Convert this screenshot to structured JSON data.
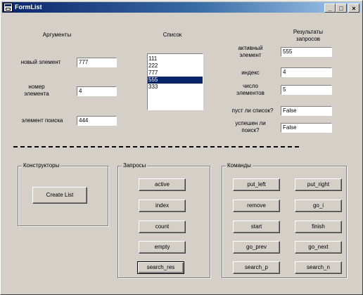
{
  "window": {
    "title": "FormList",
    "min_glyph": "_",
    "max_glyph": "□",
    "close_glyph": "×"
  },
  "labels": {
    "args_header": "Аргументы",
    "list_header": "Список",
    "results_header": "Результаты запросов",
    "new_item": "новый элемент",
    "item_number": "номер элемента",
    "search_item": "элемент поиска",
    "active_item": "активный элемент",
    "index": "индекс",
    "count": "число элементов",
    "is_empty": "пуст ли список?",
    "search_success": "успешен ли поиск?"
  },
  "inputs": {
    "new_item": "777",
    "item_number": "4",
    "search_item": "444",
    "active_item": "555",
    "index": "4",
    "count": "5",
    "is_empty": "False",
    "search_success": "False"
  },
  "list": {
    "items": [
      "111",
      "222",
      "777",
      "555",
      "333"
    ],
    "selected_index": 3
  },
  "groups": {
    "constructors": "Конструкторы",
    "queries": "Запросы",
    "commands": "Команды"
  },
  "buttons": {
    "create_list": "Create List",
    "queries": [
      "active",
      "index",
      "count",
      "empty",
      "search_res"
    ],
    "commands_left": [
      "put_left",
      "remove",
      "start",
      "go_prev",
      "search_p"
    ],
    "commands_right": [
      "put_right",
      "go_i",
      "finish",
      "go_next",
      "search_n"
    ]
  }
}
